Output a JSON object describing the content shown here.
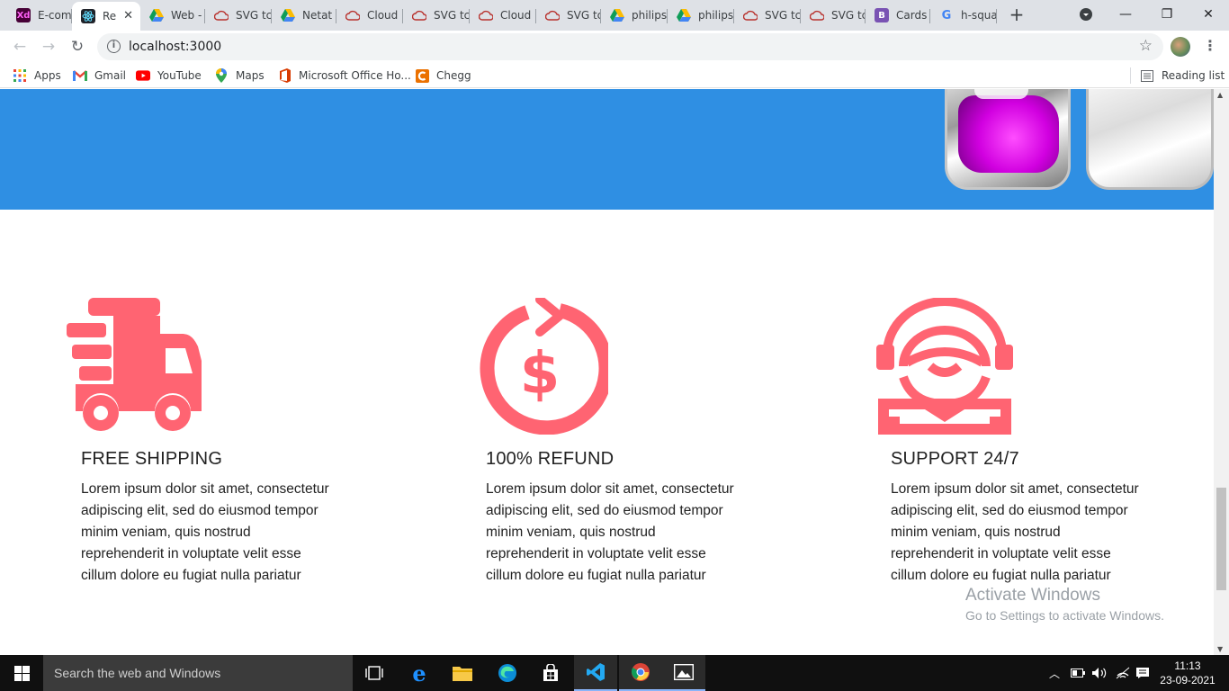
{
  "browser": {
    "tabs": [
      {
        "title": "E-com",
        "icon": "xd-icon",
        "color": "#470137"
      },
      {
        "title": "Re",
        "icon": "react-icon",
        "color": "#20232a",
        "active": true
      },
      {
        "title": "Web -",
        "icon": "drive-icon"
      },
      {
        "title": "SVG tc",
        "icon": "cloud-icon"
      },
      {
        "title": "Netat",
        "icon": "drive-icon"
      },
      {
        "title": "Cloud",
        "icon": "cloud-icon"
      },
      {
        "title": "SVG tc",
        "icon": "cloud-icon"
      },
      {
        "title": "Cloud",
        "icon": "cloud-icon"
      },
      {
        "title": "SVG tc",
        "icon": "cloud-icon"
      },
      {
        "title": "philips",
        "icon": "drive-icon"
      },
      {
        "title": "philips",
        "icon": "drive-icon"
      },
      {
        "title": "SVG tc",
        "icon": "cloud-icon"
      },
      {
        "title": "SVG tc",
        "icon": "cloud-icon"
      },
      {
        "title": "Cards",
        "icon": "bootstrap-icon",
        "color": "#7952b3"
      },
      {
        "title": "h-squa",
        "icon": "google-icon"
      }
    ],
    "url": "localhost:3000",
    "bookmarks": [
      {
        "label": "Apps",
        "icon": "apps-grid-icon"
      },
      {
        "label": "Gmail",
        "icon": "gmail-icon"
      },
      {
        "label": "YouTube",
        "icon": "youtube-icon"
      },
      {
        "label": "Maps",
        "icon": "maps-icon"
      },
      {
        "label": "Microsoft Office Ho...",
        "icon": "office-icon"
      },
      {
        "label": "Chegg",
        "icon": "chegg-icon"
      }
    ],
    "reading_list": "Reading list"
  },
  "page": {
    "accent_color": "#2f8fe3",
    "icon_color": "#ff6472",
    "features": [
      {
        "title": "FREE SHIPPING",
        "text": "Lorem ipsum dolor sit amet, consectetur adipiscing elit, sed do eiusmod tempor minim veniam, quis nostrud reprehenderit in voluptate velit esse cillum dolore eu fugiat nulla pariatur",
        "icon": "delivery-truck-icon"
      },
      {
        "title": "100% REFUND",
        "text": "Lorem ipsum dolor sit amet, consectetur adipiscing elit, sed do eiusmod tempor minim veniam, quis nostrud reprehenderit in voluptate velit esse cillum dolore eu fugiat nulla pariatur",
        "icon": "refund-dollar-icon"
      },
      {
        "title": "SUPPORT 24/7",
        "text": "Lorem ipsum dolor sit amet, consectetur adipiscing elit, sed do eiusmod tempor minim veniam, quis nostrud reprehenderit in voluptate velit esse cillum dolore eu fugiat nulla pariatur",
        "icon": "support-agent-icon"
      }
    ]
  },
  "windows": {
    "activate_title": "Activate Windows",
    "activate_sub": "Go to Settings to activate Windows.",
    "search_placeholder": "Search the web and Windows",
    "time": "11:13",
    "date": "23-09-2021"
  }
}
